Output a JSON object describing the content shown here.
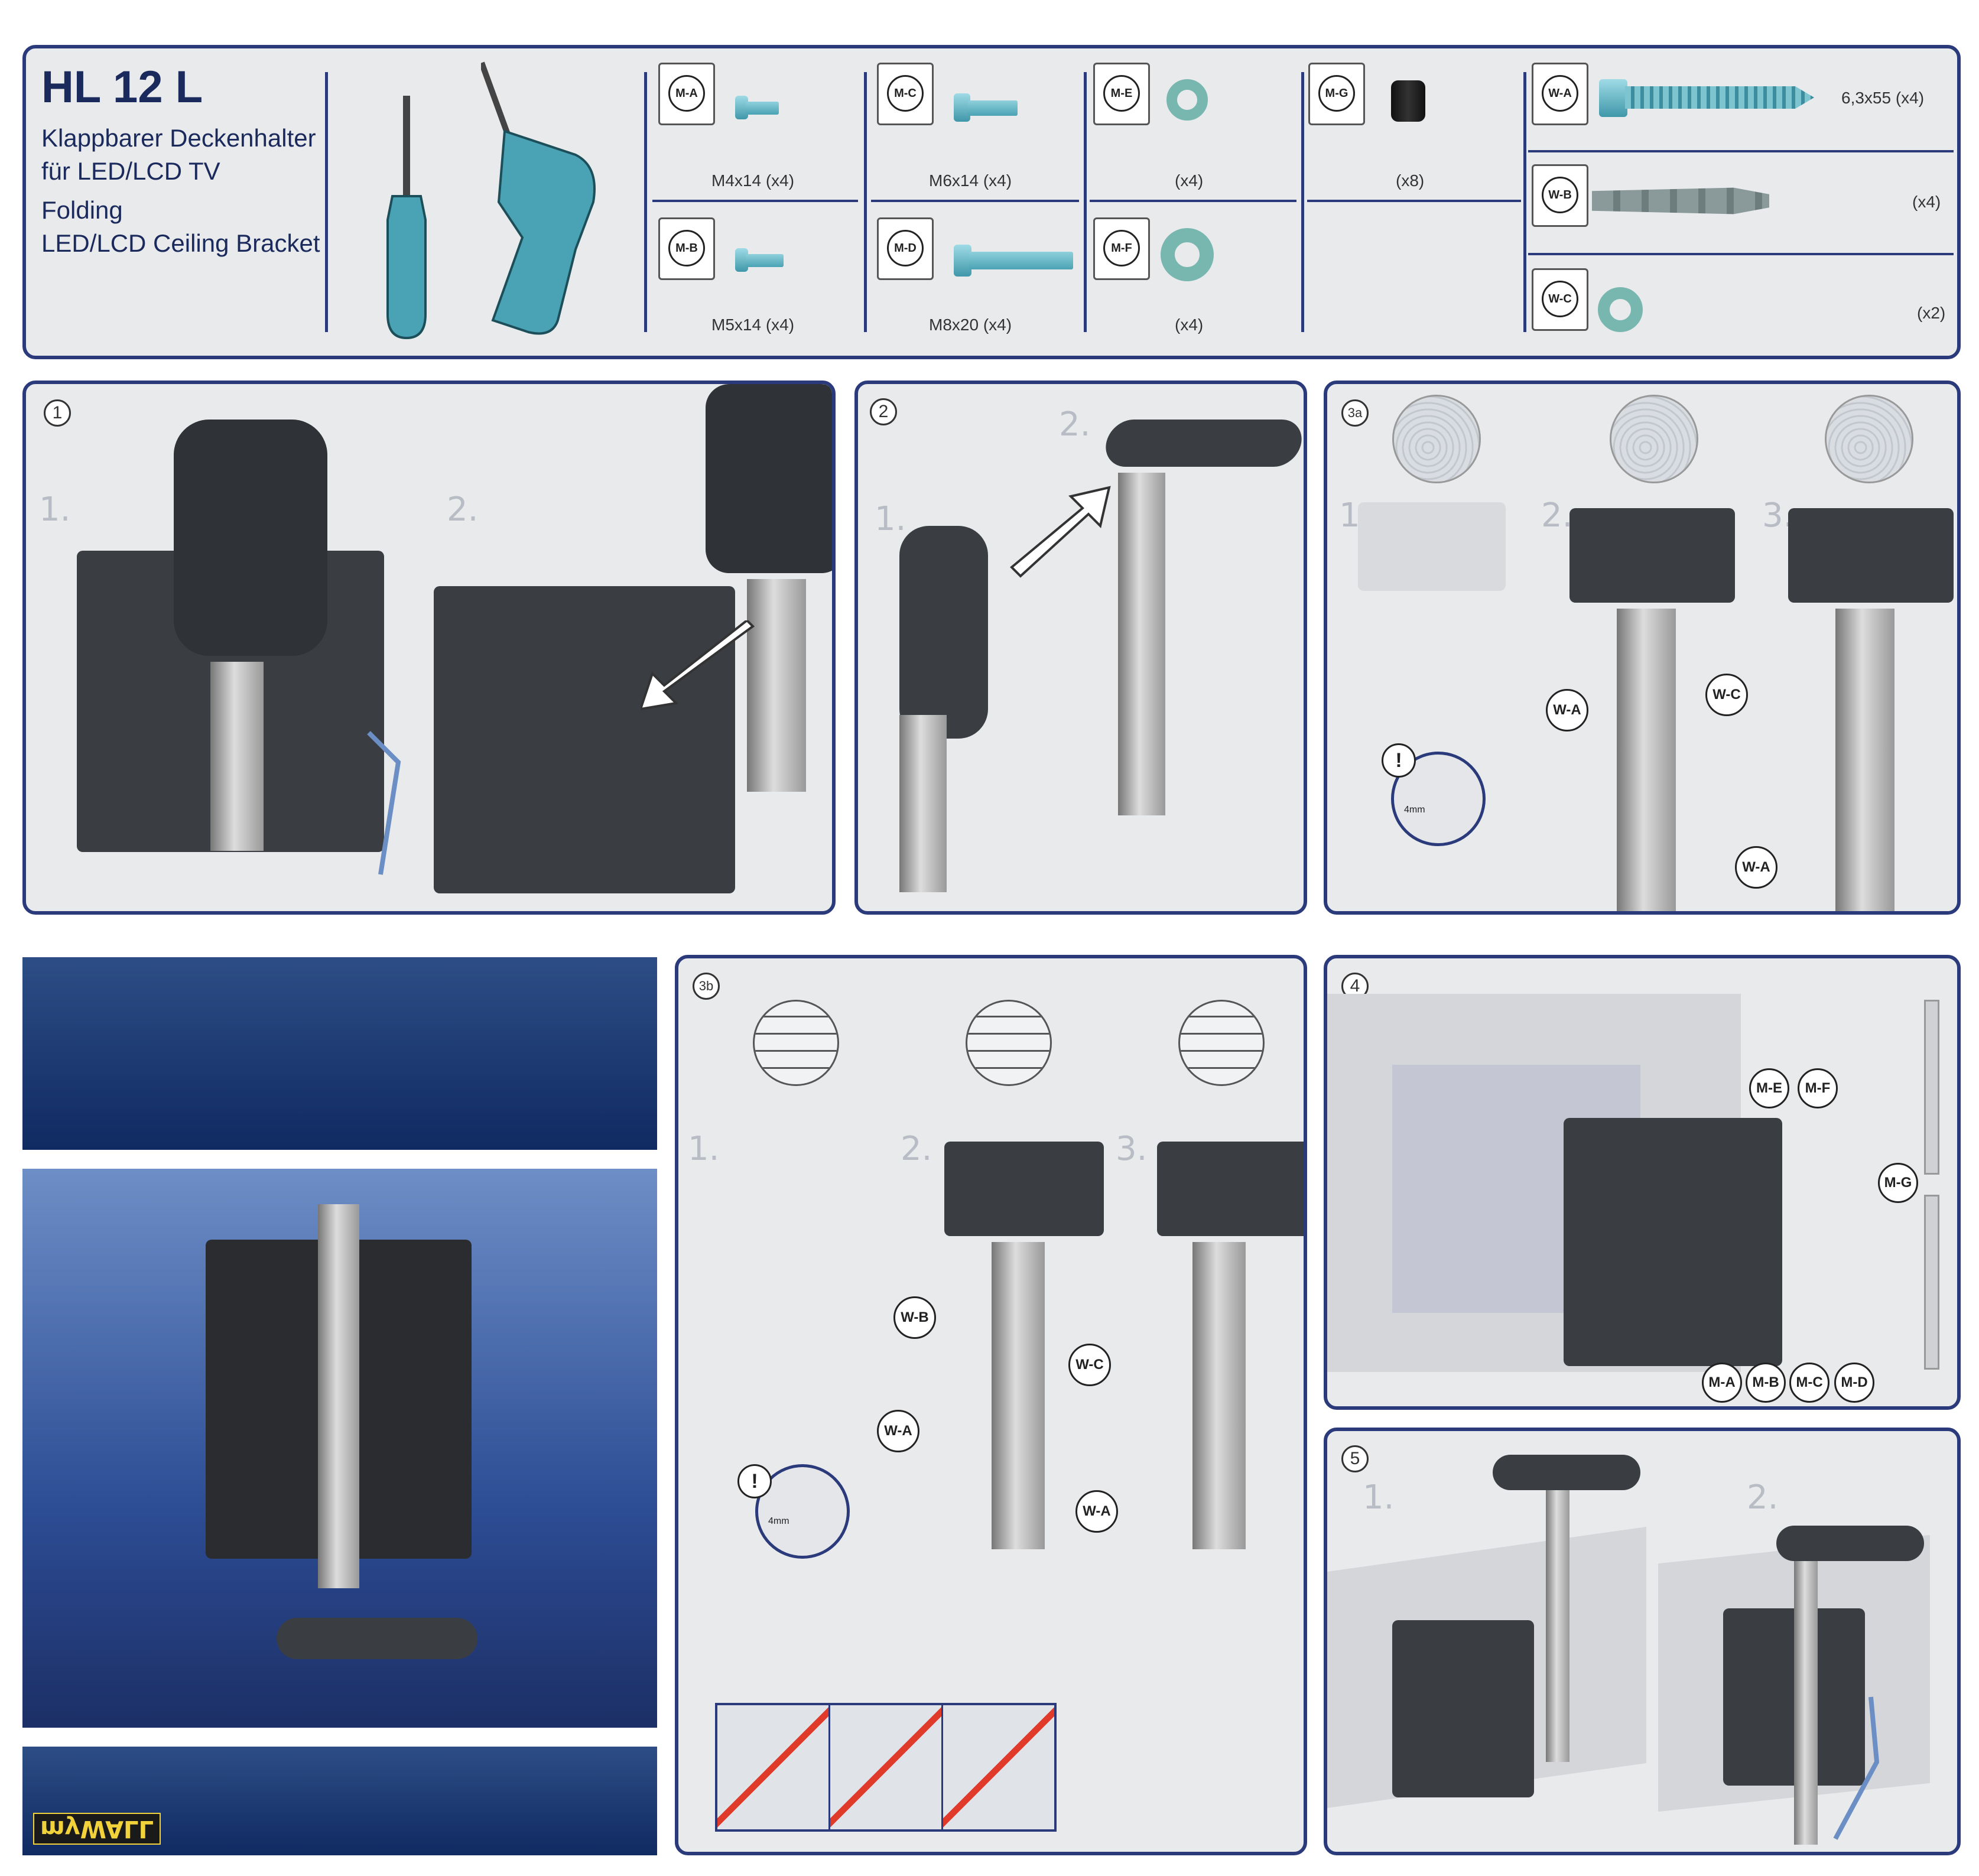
{
  "header": {
    "model": "HL 12 L",
    "title_de_1": "Klappbarer Deckenhalter",
    "title_de_2": "für LED/LCD TV",
    "title_en_1": "Folding",
    "title_en_2": "LED/LCD Ceiling Bracket"
  },
  "parts": {
    "ma": {
      "code": "M-A",
      "label": "M4x14 (x4)"
    },
    "mb": {
      "code": "M-B",
      "label": "M5x14 (x4)"
    },
    "mc": {
      "code": "M-C",
      "label": "M6x14 (x4)"
    },
    "md": {
      "code": "M-D",
      "label": "M8x20 (x4)"
    },
    "me": {
      "code": "M-E",
      "label": "(x4)"
    },
    "mf": {
      "code": "M-F",
      "label": "(x4)"
    },
    "mg": {
      "code": "M-G",
      "label": "(x8)"
    },
    "wa": {
      "code": "W-A",
      "label": "6,3x55 (x4)"
    },
    "wb": {
      "code": "W-B",
      "label": "(x4)"
    },
    "wc": {
      "code": "W-C",
      "label": "(x2)"
    }
  },
  "steps": {
    "s1": "1",
    "s2": "2",
    "s3a": "3a",
    "s3b": "3b",
    "s4": "4",
    "s5": "5"
  },
  "substeps": {
    "one": "1.",
    "two": "2.",
    "three": "3."
  },
  "callouts": {
    "wa": "W-A",
    "wb": "W-B",
    "wc": "W-C",
    "ma": "M-A",
    "mb": "M-B",
    "mc": "M-C",
    "md": "M-D",
    "me": "M-E",
    "mf": "M-F",
    "mg": "M-G",
    "depth": "4mm",
    "warn": "!"
  },
  "brand": "myWALL",
  "colors": {
    "frame": "#2a3a7a",
    "panel_bg": "#e9eaec",
    "accent": "#4aa3b4"
  }
}
